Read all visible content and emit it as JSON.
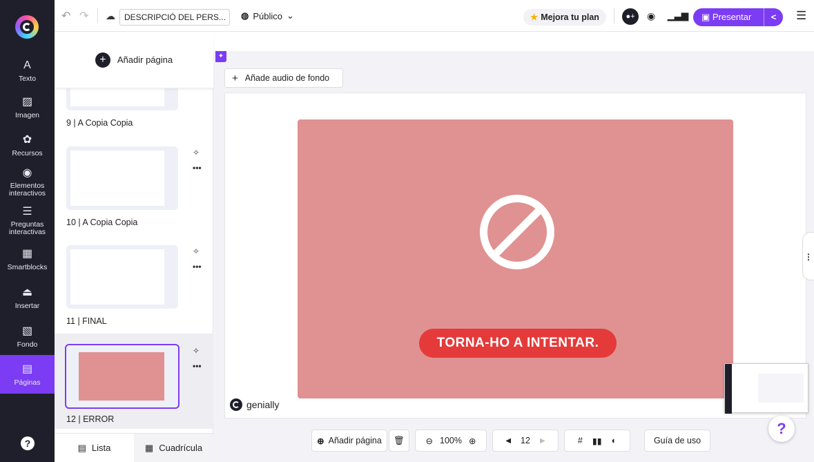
{
  "sidebar": {
    "items": [
      {
        "icon": "A",
        "label": "Texto"
      },
      {
        "icon": "▨",
        "label": "Imagen"
      },
      {
        "icon": "✿",
        "label": "Recursos"
      },
      {
        "icon": "◉",
        "label": "Elementos interactivos"
      },
      {
        "icon": "☰",
        "label": "Preguntas interactivas"
      },
      {
        "icon": "▦",
        "label": "Smartblocks"
      },
      {
        "icon": "⏏",
        "label": "Insertar"
      },
      {
        "icon": "▧",
        "label": "Fondo"
      },
      {
        "icon": "▤",
        "label": "Páginas"
      }
    ],
    "help": "?"
  },
  "topbar": {
    "title": "DESCRIPCIÓ DEL PERS...",
    "visibility": "Público",
    "upgrade": "Mejora tu plan",
    "present": "Presentar"
  },
  "pages": {
    "add_label": "Añadir página",
    "items": [
      {
        "label": "9 | A Copia Copia"
      },
      {
        "label": "10 | A Copia Copia"
      },
      {
        "label": "11 | FINAL"
      },
      {
        "label": "12 | ERROR"
      }
    ],
    "tabs": {
      "list": "Lista",
      "grid": "Cuadrícula"
    }
  },
  "canvas": {
    "audio_label": "Añade audio de fondo",
    "slide_button": "TORNA-HO A INTENTAR.",
    "brand": "genially"
  },
  "bottombar": {
    "add_page": "Añadir página",
    "zoom": "100%",
    "page_number": "12",
    "guide": "Guía de uso"
  },
  "colors": {
    "accent": "#7b3cf3",
    "slide_bg": "#e09191",
    "retry_btn": "#e53a3a",
    "sidebar_bg": "#1f1f2b"
  }
}
